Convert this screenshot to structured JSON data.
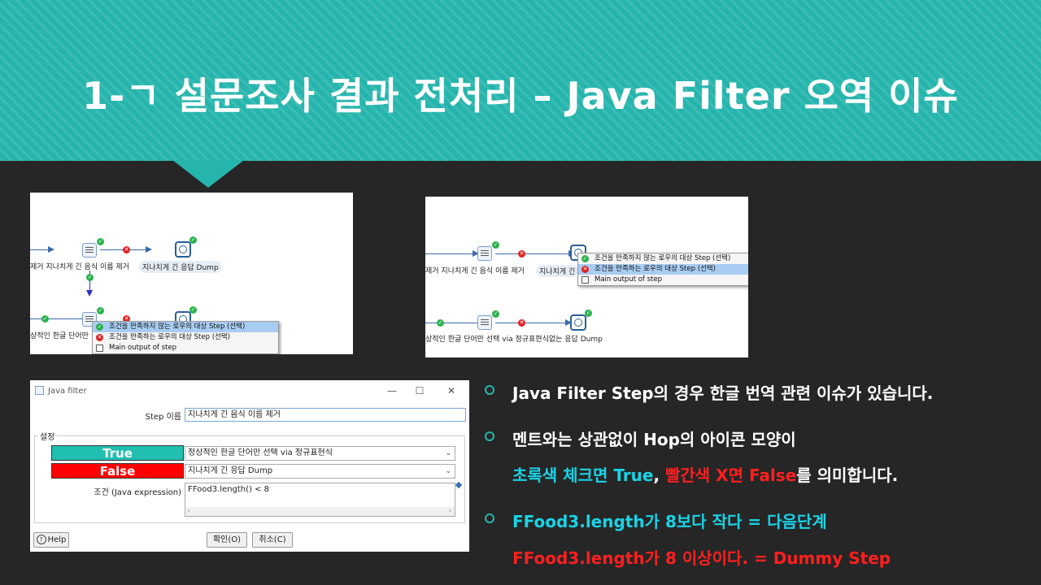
{
  "header": {
    "title": "1-ㄱ 설문조사 결과 전처리 – Java Filter 오역 이슈",
    "colors": {
      "banner": "#26b5ad",
      "background": "#262626"
    }
  },
  "screenshot1": {
    "steps": {
      "top_left_label": "제거  지나치게 긴 음식 이름 제거",
      "top_right_label": "지나치게 긴 응답 Dump",
      "bottom_left_label": "상적인 한글 단어만"
    },
    "context_menu": [
      {
        "label": "조건을 만족하지 않는 로우의 대상 Step (선택)",
        "icon": "check-icon",
        "selected": true
      },
      {
        "label": "조건을 만족하는 로우의 대상 Step (선택)",
        "icon": "error-icon",
        "selected": false
      },
      {
        "label": "Main output of step",
        "icon": "output-icon",
        "selected": false
      }
    ]
  },
  "screenshot2": {
    "steps": {
      "top_left_label": "제거  지나치게 긴 음식 이름 제거",
      "top_right_label": "지나치게 긴",
      "bottom_label": "상적인 한글 단어만 선택 via 정규표현식없는 응답 Dump"
    },
    "context_menu": [
      {
        "label": "조건을 만족하지 않는 로우의 대상 Step (선택)",
        "icon": "check-icon",
        "selected": false
      },
      {
        "label": "조건을 만족하는 로우의 대상 Step (선택)",
        "icon": "error-icon",
        "selected": true
      },
      {
        "label": "Main output of step",
        "icon": "output-icon",
        "selected": false
      }
    ]
  },
  "dialog": {
    "title": "Java filter",
    "window_buttons": {
      "minimize": "—",
      "maximize": "☐",
      "close": "✕"
    },
    "step_name_label": "Step 이름",
    "step_name_value": "지나치게 긴 음식 이름 제거",
    "group_label": "설정",
    "true_tag": "True",
    "false_tag": "False",
    "true_target": "정상적인 한글 단어만 선택 via 정규표현식",
    "false_target": "지나치게 긴 응답 Dump",
    "condition_label": "조건 (Java expression)",
    "condition_value": "FFood3.length() < 8",
    "help_button": "Help",
    "ok_button": "확인(O)",
    "cancel_button": "취소(C)"
  },
  "bullets": {
    "b1": "Java Filter Step의 경우 한글 번역 관련 이슈가 있습니다.",
    "b2_line1": "멘트와는 상관없이 Hop의 아이콘 모양이",
    "b2_line2_green": "초록색 체크면 True",
    "b2_line2_sep": ", ",
    "b2_line2_red": "빨간색 X면 False",
    "b2_line2_rest": "를 의미합니다.",
    "b3_line1": "FFood3.length가 8보다 작다 = 다음단계",
    "b3_line2": "FFood3.length가 8 이상이다. = Dummy Step",
    "colors": {
      "cyan": "#19d3e6",
      "red": "#ff1f1f",
      "bullet_ring": "#26b5ad"
    }
  }
}
